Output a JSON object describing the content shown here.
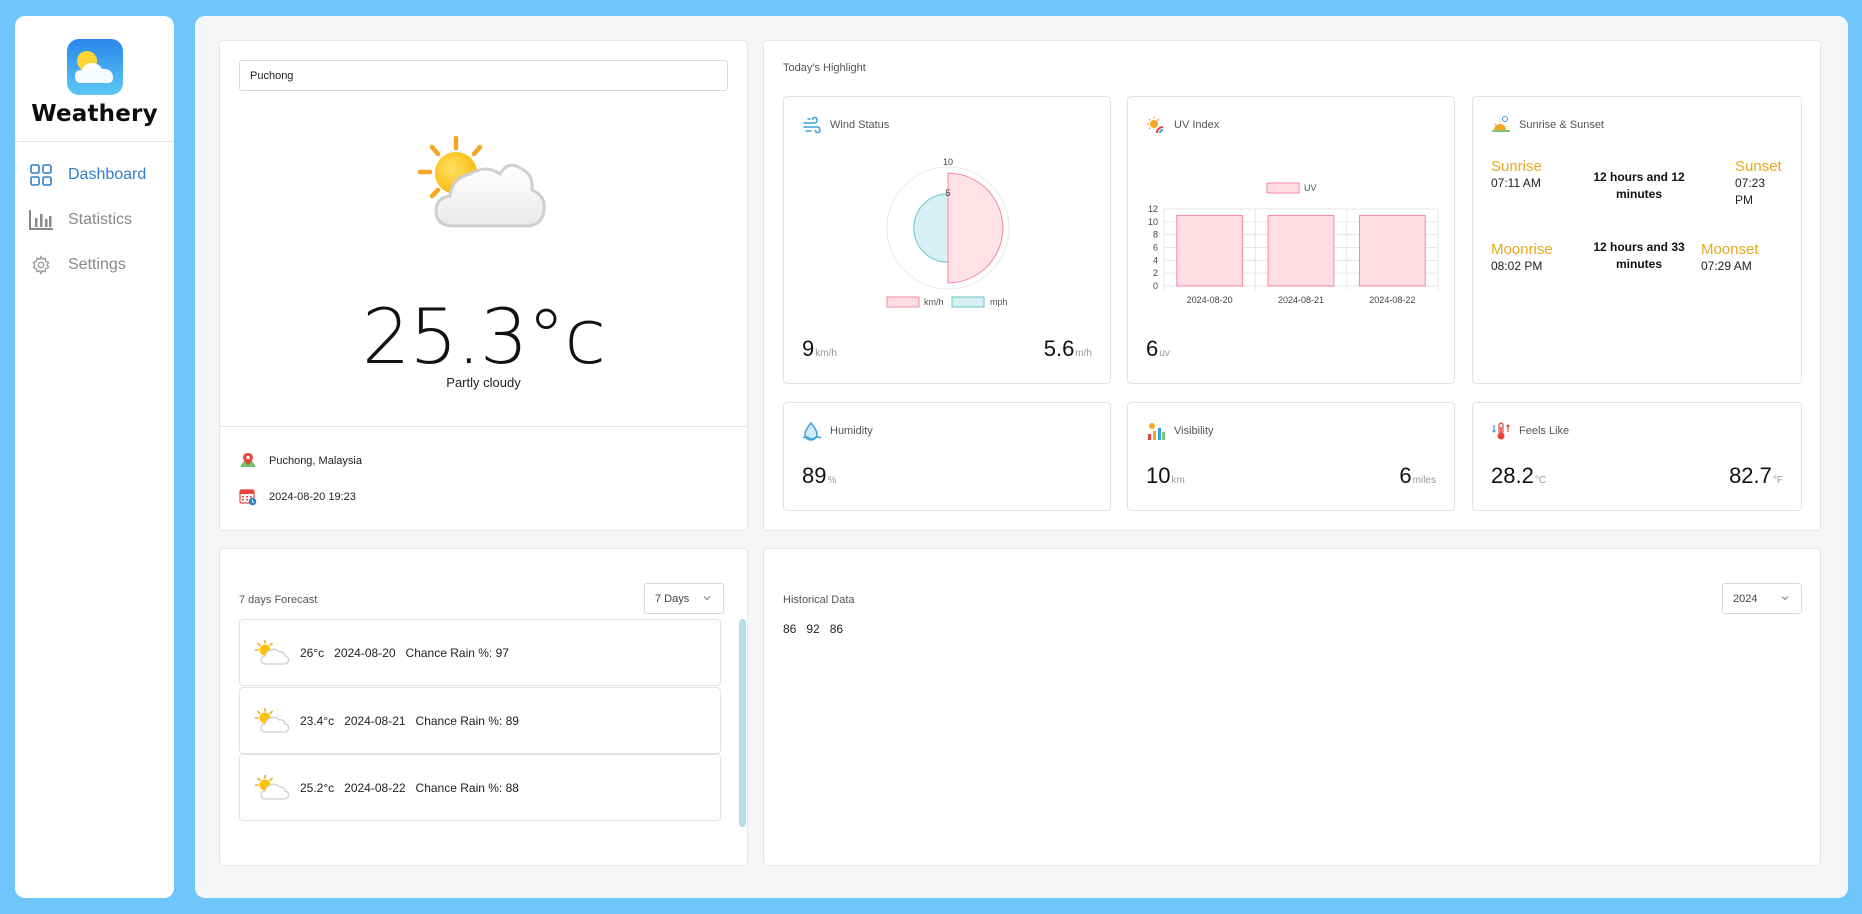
{
  "app": {
    "name": "Weathery"
  },
  "nav": [
    {
      "label": "Dashboard",
      "icon": "grid-icon",
      "active": true
    },
    {
      "label": "Statistics",
      "icon": "bar-chart-icon",
      "active": false
    },
    {
      "label": "Settings",
      "icon": "gear-icon",
      "active": false
    }
  ],
  "current": {
    "search_value": "Puchong",
    "temperature": "25.3°c",
    "condition": "Partly cloudy",
    "location": "Puchong, Malaysia",
    "datetime": "2024-08-20 19:23"
  },
  "highlight": {
    "title": "Today's Highlight",
    "wind": {
      "title": "Wind Status",
      "kmh_value": "9",
      "kmh_unit": "km/h",
      "mph_value": "5.6",
      "mph_unit": "m/h",
      "legend_kmh": "km/h",
      "legend_mph": "mph",
      "tick_top": "10",
      "tick_mid": "5"
    },
    "uv": {
      "title": "UV Index",
      "value": "6",
      "unit": "uv",
      "legend": "UV"
    },
    "sun": {
      "title": "Sunrise & Sunset",
      "sunrise_label": "Sunrise",
      "sunrise_time": "07:11 AM",
      "sunset_label": "Sunset",
      "sunset_time": "07:23 PM",
      "day_duration": "12 hours and 12 minutes",
      "moonrise_label": "Moonrise",
      "moonrise_time": "08:02 PM",
      "moonset_label": "Moonset",
      "moonset_time": "07:29 AM",
      "moon_duration": "12 hours and 33 minutes"
    },
    "humidity": {
      "title": "Humidity",
      "value": "89",
      "unit": "%"
    },
    "visibility": {
      "title": "Visibility",
      "km_value": "10",
      "km_unit": "km",
      "miles_value": "6",
      "miles_unit": "miles"
    },
    "feels": {
      "title": "Feels Like",
      "c_value": "28.2",
      "c_unit": "°C",
      "f_value": "82.7",
      "f_unit": "°F"
    }
  },
  "forecast": {
    "title": "7 days Forecast",
    "select": "7 Days",
    "items": [
      {
        "temp": "26°c",
        "date": "2024-08-20",
        "rain": "Chance Rain %: 97"
      },
      {
        "temp": "23.4°c",
        "date": "2024-08-21",
        "rain": "Chance Rain %: 89"
      },
      {
        "temp": "25.2°c",
        "date": "2024-08-22",
        "rain": "Chance Rain %: 88"
      }
    ]
  },
  "history": {
    "title": "Historical Data",
    "select": "2024",
    "values": [
      "86",
      "92",
      "86"
    ]
  },
  "colors": {
    "bg": "#6ec6fa",
    "accent": "#2e7fc7",
    "sun": "#e8a81c",
    "uv_bar_fill": "#ffdde4",
    "uv_bar_stroke": "#f08aa0",
    "mph_fill": "#d6f0f2",
    "mph_stroke": "#6cc4c8"
  },
  "chart_data": [
    {
      "type": "polar-area",
      "chart": "wind",
      "categories": [
        "km/h",
        "mph"
      ],
      "values": [
        9,
        5.6
      ],
      "rmax": 10,
      "ticks": [
        5,
        10
      ]
    },
    {
      "type": "bar",
      "chart": "uv",
      "categories": [
        "2024-08-20",
        "2024-08-21",
        "2024-08-22"
      ],
      "series": [
        {
          "name": "UV",
          "values": [
            11,
            11,
            11
          ]
        }
      ],
      "ylim": [
        0,
        12
      ],
      "yticks": [
        0,
        2,
        4,
        6,
        8,
        10,
        12
      ],
      "legend": "top"
    }
  ]
}
